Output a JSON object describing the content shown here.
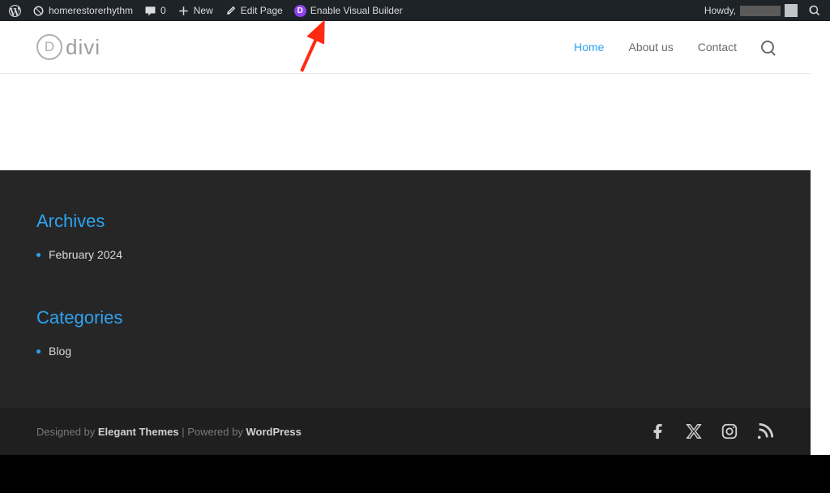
{
  "adminbar": {
    "site_name": "homerestorerhythm",
    "comments_count": "0",
    "new_label": "New",
    "edit_page_label": "Edit Page",
    "visual_builder_label": "Enable Visual Builder",
    "howdy_prefix": "Howdy,"
  },
  "header": {
    "logo_letter": "D",
    "logo_text": "divi",
    "nav": {
      "home": "Home",
      "about": "About us",
      "contact": "Contact"
    }
  },
  "widgets": {
    "archives": {
      "title": "Archives",
      "items": [
        "February 2024"
      ]
    },
    "categories": {
      "title": "Categories",
      "items": [
        "Blog"
      ]
    }
  },
  "footer": {
    "designed_prefix": "Designed by ",
    "designed_link": "Elegant Themes",
    "powered_sep": " | Powered by ",
    "powered_link": "WordPress"
  }
}
